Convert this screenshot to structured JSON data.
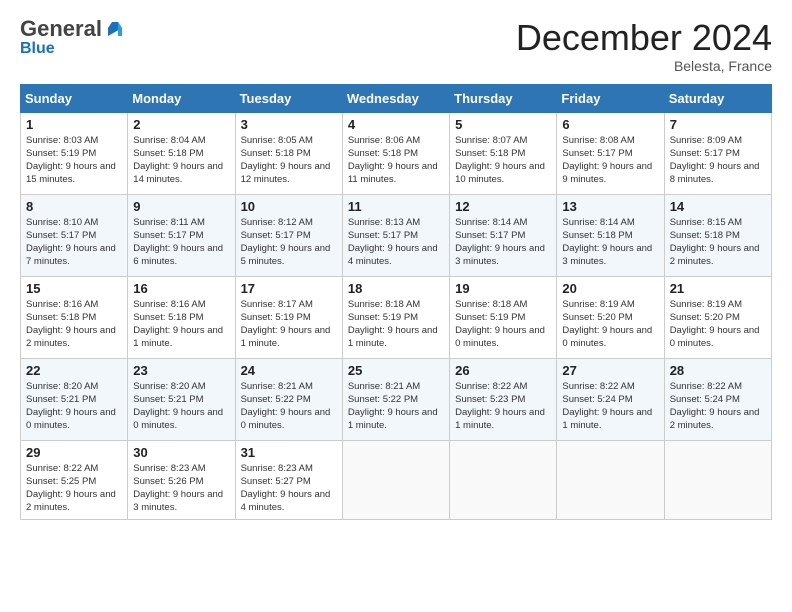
{
  "header": {
    "logo_general": "General",
    "logo_blue": "Blue",
    "month_title": "December 2024",
    "subtitle": "Belesta, France"
  },
  "days_of_week": [
    "Sunday",
    "Monday",
    "Tuesday",
    "Wednesday",
    "Thursday",
    "Friday",
    "Saturday"
  ],
  "weeks": [
    [
      {
        "day": "1",
        "sunrise": "8:03 AM",
        "sunset": "5:19 PM",
        "daylight": "9 hours and 15 minutes."
      },
      {
        "day": "2",
        "sunrise": "8:04 AM",
        "sunset": "5:18 PM",
        "daylight": "9 hours and 14 minutes."
      },
      {
        "day": "3",
        "sunrise": "8:05 AM",
        "sunset": "5:18 PM",
        "daylight": "9 hours and 12 minutes."
      },
      {
        "day": "4",
        "sunrise": "8:06 AM",
        "sunset": "5:18 PM",
        "daylight": "9 hours and 11 minutes."
      },
      {
        "day": "5",
        "sunrise": "8:07 AM",
        "sunset": "5:18 PM",
        "daylight": "9 hours and 10 minutes."
      },
      {
        "day": "6",
        "sunrise": "8:08 AM",
        "sunset": "5:17 PM",
        "daylight": "9 hours and 9 minutes."
      },
      {
        "day": "7",
        "sunrise": "8:09 AM",
        "sunset": "5:17 PM",
        "daylight": "9 hours and 8 minutes."
      }
    ],
    [
      {
        "day": "8",
        "sunrise": "8:10 AM",
        "sunset": "5:17 PM",
        "daylight": "9 hours and 7 minutes."
      },
      {
        "day": "9",
        "sunrise": "8:11 AM",
        "sunset": "5:17 PM",
        "daylight": "9 hours and 6 minutes."
      },
      {
        "day": "10",
        "sunrise": "8:12 AM",
        "sunset": "5:17 PM",
        "daylight": "9 hours and 5 minutes."
      },
      {
        "day": "11",
        "sunrise": "8:13 AM",
        "sunset": "5:17 PM",
        "daylight": "9 hours and 4 minutes."
      },
      {
        "day": "12",
        "sunrise": "8:14 AM",
        "sunset": "5:17 PM",
        "daylight": "9 hours and 3 minutes."
      },
      {
        "day": "13",
        "sunrise": "8:14 AM",
        "sunset": "5:18 PM",
        "daylight": "9 hours and 3 minutes."
      },
      {
        "day": "14",
        "sunrise": "8:15 AM",
        "sunset": "5:18 PM",
        "daylight": "9 hours and 2 minutes."
      }
    ],
    [
      {
        "day": "15",
        "sunrise": "8:16 AM",
        "sunset": "5:18 PM",
        "daylight": "9 hours and 2 minutes."
      },
      {
        "day": "16",
        "sunrise": "8:16 AM",
        "sunset": "5:18 PM",
        "daylight": "9 hours and 1 minute."
      },
      {
        "day": "17",
        "sunrise": "8:17 AM",
        "sunset": "5:19 PM",
        "daylight": "9 hours and 1 minute."
      },
      {
        "day": "18",
        "sunrise": "8:18 AM",
        "sunset": "5:19 PM",
        "daylight": "9 hours and 1 minute."
      },
      {
        "day": "19",
        "sunrise": "8:18 AM",
        "sunset": "5:19 PM",
        "daylight": "9 hours and 0 minutes."
      },
      {
        "day": "20",
        "sunrise": "8:19 AM",
        "sunset": "5:20 PM",
        "daylight": "9 hours and 0 minutes."
      },
      {
        "day": "21",
        "sunrise": "8:19 AM",
        "sunset": "5:20 PM",
        "daylight": "9 hours and 0 minutes."
      }
    ],
    [
      {
        "day": "22",
        "sunrise": "8:20 AM",
        "sunset": "5:21 PM",
        "daylight": "9 hours and 0 minutes."
      },
      {
        "day": "23",
        "sunrise": "8:20 AM",
        "sunset": "5:21 PM",
        "daylight": "9 hours and 0 minutes."
      },
      {
        "day": "24",
        "sunrise": "8:21 AM",
        "sunset": "5:22 PM",
        "daylight": "9 hours and 0 minutes."
      },
      {
        "day": "25",
        "sunrise": "8:21 AM",
        "sunset": "5:22 PM",
        "daylight": "9 hours and 1 minute."
      },
      {
        "day": "26",
        "sunrise": "8:22 AM",
        "sunset": "5:23 PM",
        "daylight": "9 hours and 1 minute."
      },
      {
        "day": "27",
        "sunrise": "8:22 AM",
        "sunset": "5:24 PM",
        "daylight": "9 hours and 1 minute."
      },
      {
        "day": "28",
        "sunrise": "8:22 AM",
        "sunset": "5:24 PM",
        "daylight": "9 hours and 2 minutes."
      }
    ],
    [
      {
        "day": "29",
        "sunrise": "8:22 AM",
        "sunset": "5:25 PM",
        "daylight": "9 hours and 2 minutes."
      },
      {
        "day": "30",
        "sunrise": "8:23 AM",
        "sunset": "5:26 PM",
        "daylight": "9 hours and 3 minutes."
      },
      {
        "day": "31",
        "sunrise": "8:23 AM",
        "sunset": "5:27 PM",
        "daylight": "9 hours and 4 minutes."
      },
      null,
      null,
      null,
      null
    ]
  ]
}
